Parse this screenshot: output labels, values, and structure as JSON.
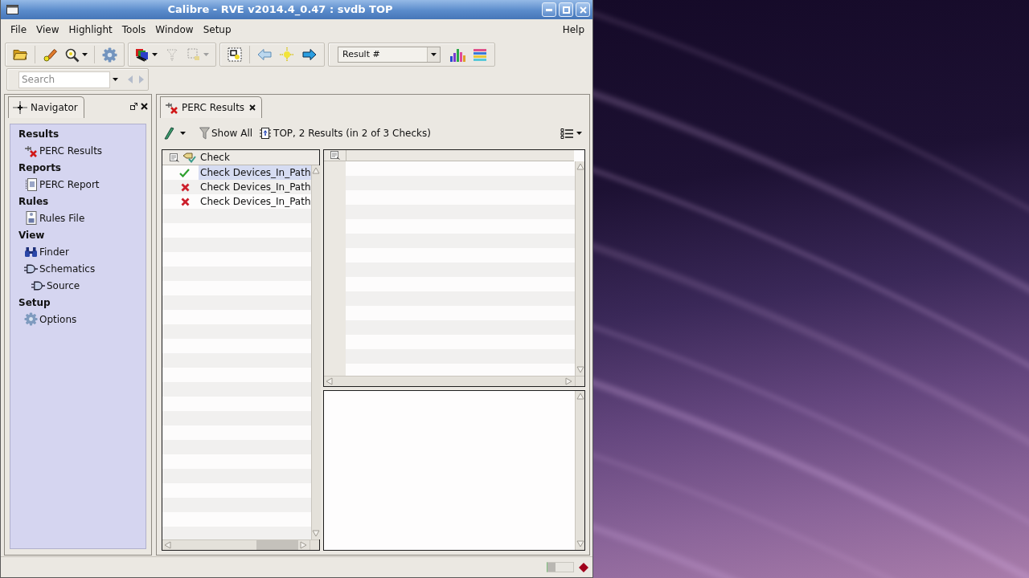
{
  "window": {
    "title": "Calibre - RVE v2014.4_0.47 : svdb TOP"
  },
  "menu_bar": {
    "items": [
      "File",
      "View",
      "Highlight",
      "Tools",
      "Window",
      "Setup"
    ],
    "help": "Help"
  },
  "toolbar": {
    "sections": [
      {
        "groups": [
          {
            "buttons": [
              {
                "kind": "open",
                "disabled": false,
                "menu": false
              }
            ]
          },
          {
            "buttons": [
              {
                "kind": "highlight",
                "disabled": false,
                "menu": false
              },
              {
                "kind": "zoom",
                "disabled": false,
                "menu": true
              }
            ]
          },
          {
            "buttons": [
              {
                "kind": "settings",
                "disabled": false,
                "menu": false
              }
            ]
          }
        ]
      },
      {
        "groups": [
          {
            "buttons": [
              {
                "kind": "layers",
                "disabled": false,
                "menu": true
              },
              {
                "kind": "clear",
                "disabled": true,
                "menu": false
              },
              {
                "kind": "select",
                "disabled": true,
                "menu": true
              }
            ]
          }
        ]
      },
      {
        "groups": [
          {
            "buttons": [
              {
                "kind": "fit",
                "disabled": false,
                "menu": false
              }
            ]
          },
          {
            "buttons": [
              {
                "kind": "back",
                "disabled": false,
                "menu": false
              },
              {
                "kind": "center",
                "disabled": false,
                "menu": false
              },
              {
                "kind": "forward",
                "disabled": false,
                "menu": false
              }
            ]
          }
        ]
      },
      {
        "dropdown": "Result #",
        "groups": [
          {
            "buttons": [
              {
                "kind": "histogram",
                "disabled": false,
                "menu": false
              },
              {
                "kind": "legend",
                "disabled": false,
                "menu": false
              }
            ]
          }
        ]
      }
    ]
  },
  "search": {
    "placeholder": "Search",
    "nav_buttons": [
      {
        "kind": "prev",
        "disabled": true
      },
      {
        "kind": "next",
        "disabled": true
      }
    ]
  },
  "navigator": {
    "tab": {
      "label": "Navigator",
      "selected": true
    },
    "sections": [
      {
        "label": "Results",
        "children": [
          {
            "label": "PERC Results",
            "kind": "results"
          }
        ]
      },
      {
        "label": "Reports",
        "children": [
          {
            "label": "PERC Report",
            "kind": "report"
          }
        ]
      },
      {
        "label": "Rules",
        "children": [
          {
            "label": "Rules File",
            "kind": "rules"
          }
        ]
      },
      {
        "label": "View",
        "children": [
          {
            "label": "Finder",
            "kind": "finder"
          },
          {
            "label": "Schematics",
            "kind": "schematic",
            "children": [
              {
                "label": "Source",
                "kind": "schematic"
              }
            ]
          }
        ]
      },
      {
        "label": "Setup",
        "children": [
          {
            "label": "Options",
            "kind": "options"
          }
        ]
      }
    ]
  },
  "results_panel": {
    "tab": {
      "label": "PERC Results",
      "selected": true
    },
    "show_all": "Show All",
    "summary": "TOP, 2 Results (in 2 of 3 Checks)",
    "table": {
      "columns": [
        "Check"
      ],
      "rows": [
        {
          "kind": "pass",
          "check": "Check Devices_In_Path",
          "selected": true
        },
        {
          "kind": "fail",
          "check": "Check Devices_In_Path",
          "selected": false
        },
        {
          "kind": "fail",
          "check": "Check Devices_In_Path",
          "selected": false
        }
      ]
    }
  },
  "status_bar": {
    "progress": {
      "level": 0.3
    }
  }
}
